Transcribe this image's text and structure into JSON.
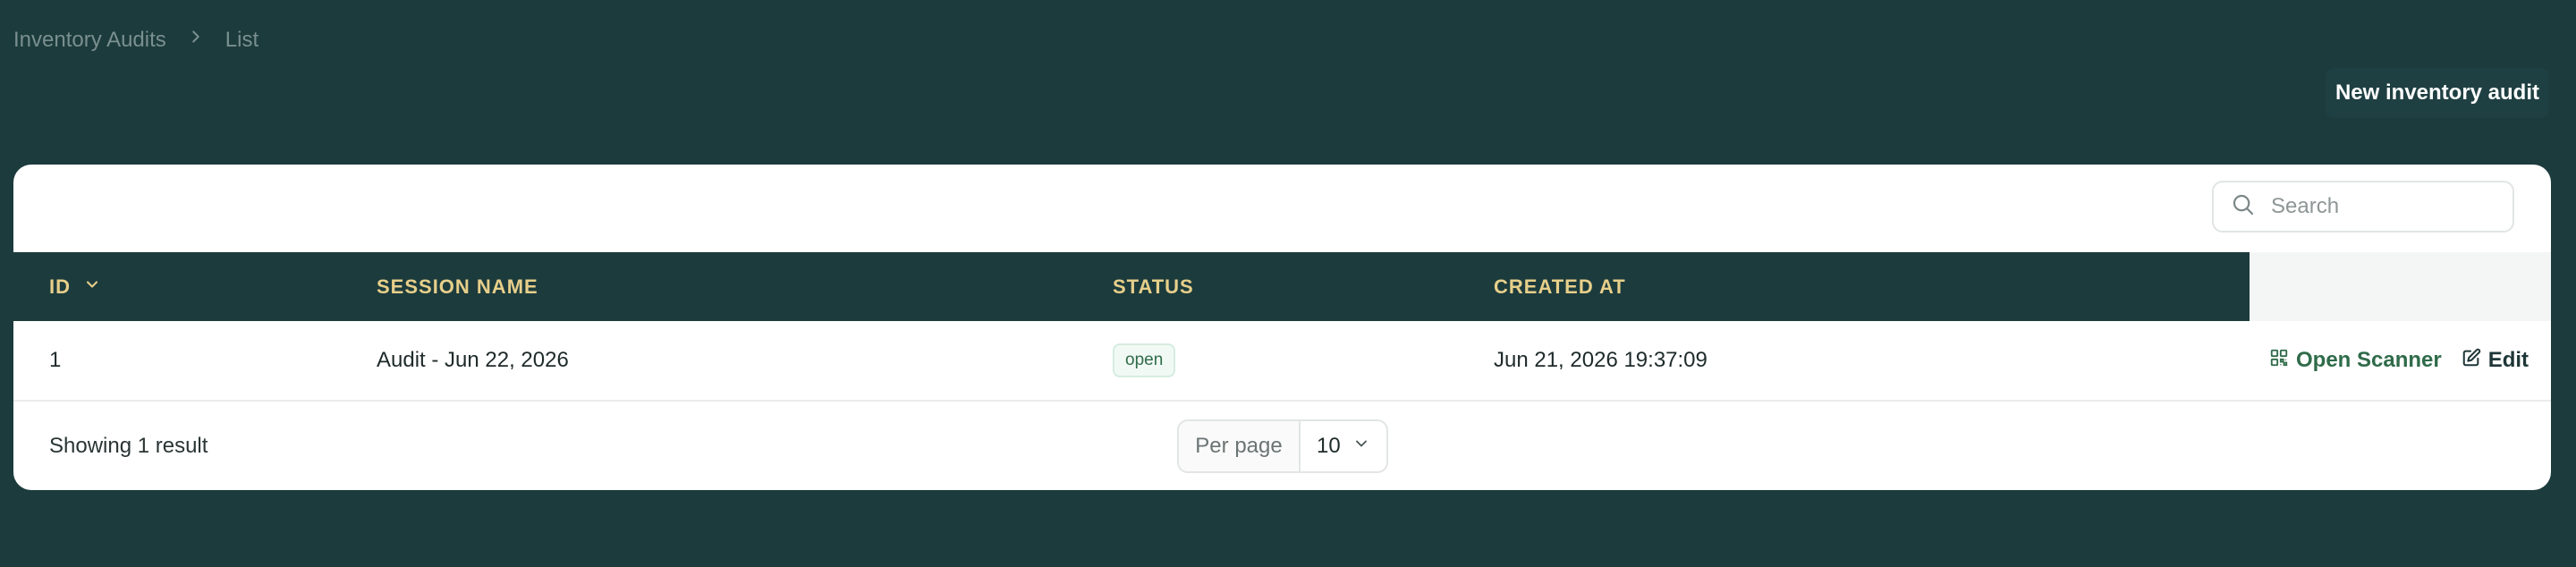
{
  "breadcrumb": {
    "items": [
      "Inventory Audits",
      "List"
    ],
    "separator_icon": "chevron-right-icon"
  },
  "header": {
    "new_button_label": "New inventory audit"
  },
  "search": {
    "placeholder": "Search",
    "value": "",
    "icon": "search-icon"
  },
  "table": {
    "columns": [
      {
        "label": "ID",
        "sorted": "desc"
      },
      {
        "label": "SESSION NAME"
      },
      {
        "label": "STATUS"
      },
      {
        "label": "CREATED AT"
      }
    ],
    "rows": [
      {
        "id": "1",
        "session_name": "Audit - Jun 22, 2026",
        "status": "open",
        "created_at": "Jun 21, 2026 19:37:09",
        "actions": {
          "open_scanner": "Open Scanner",
          "edit": "Edit"
        }
      }
    ]
  },
  "footer": {
    "showing_text": "Showing 1 result",
    "per_page_label": "Per page",
    "per_page_value": "10"
  },
  "colors": {
    "background": "#1c3b3d",
    "header_text": "#e7cf8a",
    "accent_green": "#2f6b4a",
    "card": "#ffffff"
  }
}
